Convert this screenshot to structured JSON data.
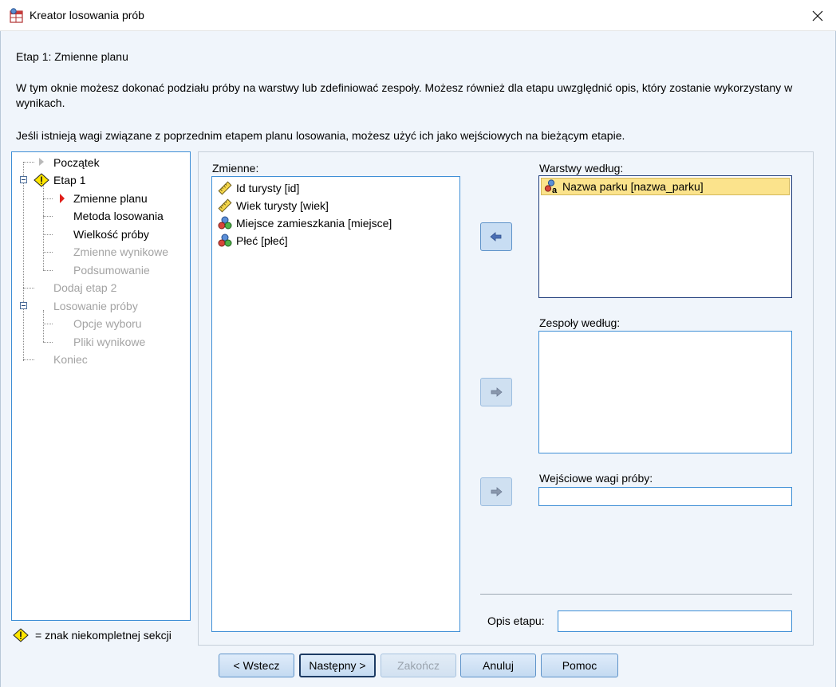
{
  "window": {
    "title": "Kreator losowania prób",
    "icon": "sampling-wizard-icon",
    "close_icon": "close-icon"
  },
  "header": {
    "step_title": "Etap 1: Zmienne planu",
    "description": "W tym oknie możesz dokonać podziału próby na warstwy lub zdefiniować zespoły. Możesz również dla etapu uwzględnić opis, który zostanie wykorzystany w wynikach.",
    "weights_note": "Jeśli istnieją wagi związane z poprzednim etapem planu losowania, możesz użyć ich jako wejściowych na bieżącym etapie."
  },
  "tree": {
    "items": [
      {
        "label": "Początek",
        "state": "normal"
      },
      {
        "label": "Etap 1",
        "state": "normal"
      },
      {
        "label": "Zmienne planu",
        "state": "current"
      },
      {
        "label": "Metoda losowania",
        "state": "normal"
      },
      {
        "label": "Wielkość próby",
        "state": "normal"
      },
      {
        "label": "Zmienne wynikowe",
        "state": "dim"
      },
      {
        "label": "Podsumowanie",
        "state": "dim"
      },
      {
        "label": "Dodaj etap 2",
        "state": "dim"
      },
      {
        "label": "Losowanie próby",
        "state": "dim"
      },
      {
        "label": "Opcje wyboru",
        "state": "dim"
      },
      {
        "label": "Pliki wynikowe",
        "state": "dim"
      },
      {
        "label": "Koniec",
        "state": "dim"
      }
    ],
    "legend": "= znak niekompletnej sekcji"
  },
  "variables": {
    "label": "Zmienne:",
    "items": [
      {
        "label": "Id turysty [id]",
        "icon": "scale-ruler-icon"
      },
      {
        "label": "Wiek turysty [wiek]",
        "icon": "scale-ruler-icon"
      },
      {
        "label": "Miejsce zamieszkania [miejsce]",
        "icon": "nominal-balls-icon"
      },
      {
        "label": "Płeć [płeć]",
        "icon": "nominal-balls-icon"
      }
    ]
  },
  "strata": {
    "label": "Warstwy według:",
    "items": [
      {
        "label": "Nazwa parku [nazwa_parku]",
        "icon": "nominal-string-icon"
      }
    ]
  },
  "clusters": {
    "label": "Zespoły według:"
  },
  "input_weights": {
    "label": "Wejściowe wagi próby:",
    "value": ""
  },
  "stage_label": {
    "label": "Opis etapu:",
    "value": ""
  },
  "buttons": {
    "back": "< Wstecz",
    "next": "Następny >",
    "finish": "Zakończ",
    "cancel": "Anuluj",
    "help": "Pomoc"
  },
  "colors": {
    "accent": "#3f8fd6",
    "selection": "#fbe38c",
    "current_marker": "#e0201b",
    "arrow": "#4a6fb5"
  }
}
